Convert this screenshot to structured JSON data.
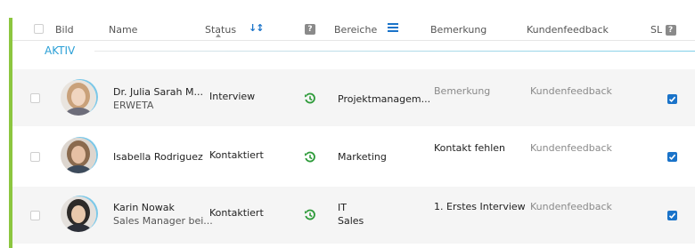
{
  "header": {
    "bild": "Bild",
    "name": "Name",
    "status": "Status",
    "bereiche": "Bereiche",
    "bemerkung": "Bemerkung",
    "kundenfeedback": "Kundenfeedback",
    "sl": "SL",
    "help_badge": "?",
    "sort_icon": "↓↕"
  },
  "group": {
    "label": "AKTIV"
  },
  "rows": [
    {
      "name": "Dr. Julia Sarah M...",
      "company": "ERWETA",
      "status": "Interview",
      "bereiche": [
        "Projektmanagem..."
      ],
      "bemerkung": "Bemerkung",
      "bemerkung_placeholder": true,
      "kundenfeedback": "Kundenfeedback",
      "sl_checked": true,
      "avatar_hair": "#c9a17a",
      "avatar_skin": "#f0d5c0"
    },
    {
      "name": "Isabella Rodriguez",
      "company": "",
      "status": "Kontaktiert",
      "bereiche": [
        "Marketing"
      ],
      "bemerkung": "Kontakt fehlen",
      "bemerkung_placeholder": false,
      "kundenfeedback": "Kundenfeedback",
      "sl_checked": true,
      "avatar_hair": "#8a6a4e",
      "avatar_skin": "#e6c0a4"
    },
    {
      "name": "Karin Nowak",
      "company": "Sales Manager bei...",
      "status": "Kontaktiert",
      "bereiche": [
        "IT",
        "Sales"
      ],
      "bemerkung": "1. Erstes Interview",
      "bemerkung_placeholder": false,
      "kundenfeedback": "Kundenfeedback",
      "sl_checked": true,
      "avatar_hair": "#2d2a28",
      "avatar_skin": "#e8c8ac"
    }
  ],
  "colors": {
    "accent_blue": "#1a73c9",
    "group_label": "#2a9fd6",
    "left_bar_green": "#8cc63f",
    "history_icon_green": "#2e9b3a"
  },
  "icons": {
    "history": "history-icon",
    "menu": "list-menu-icon",
    "sort": "sort-icon"
  }
}
